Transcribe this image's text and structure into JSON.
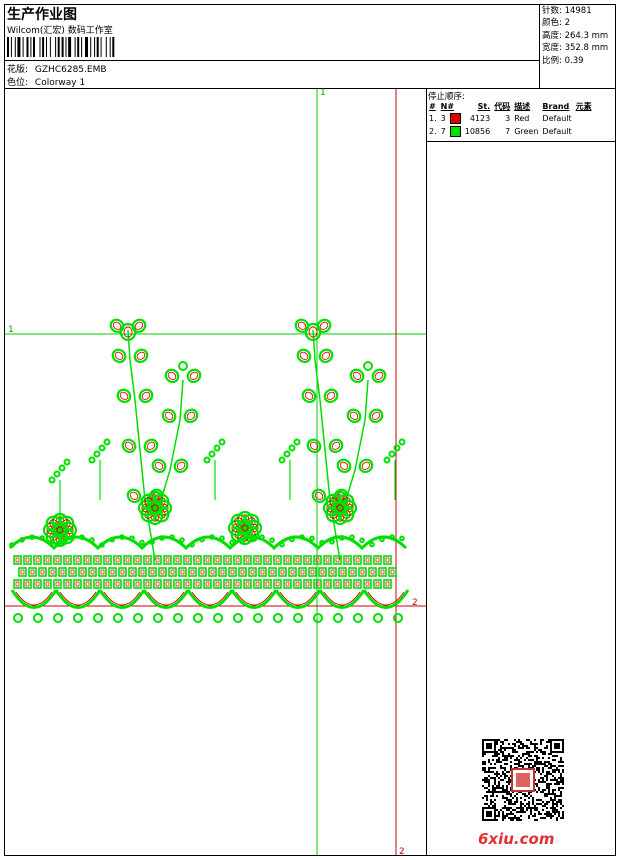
{
  "header": {
    "title": "生产作业图",
    "company": "Wilcom(汇宏) 数码工作室",
    "pattern_label": "花版:",
    "pattern_value": "GZHC6285.EMB",
    "colorway_label": "色位:",
    "colorway_value": "Colorway 1"
  },
  "stats": [
    {
      "label": "针数:",
      "value": "14981"
    },
    {
      "label": "颜色:",
      "value": "2"
    },
    {
      "label": "高度:",
      "value": "264.3 mm"
    },
    {
      "label": "宽度:",
      "value": "352.8 mm"
    },
    {
      "label": "比例:",
      "value": "0.39"
    }
  ],
  "stop_sequence": {
    "title": "停止顺序:",
    "columns": [
      "#",
      "N#",
      "St.",
      "代码",
      "描述",
      "Brand",
      "元素"
    ],
    "rows": [
      {
        "num": "1.",
        "n": "3",
        "color": "#e00000",
        "stitches": "4123",
        "code": "3",
        "desc": "Red",
        "brand": "Default"
      },
      {
        "num": "2.",
        "n": "7",
        "color": "#00e000",
        "stitches": "10856",
        "code": "7",
        "desc": "Green",
        "brand": "Default"
      }
    ]
  },
  "guides": {
    "green_top": "1",
    "green_left": "1",
    "red_right": "2",
    "red_bottom": "2"
  },
  "colors": {
    "red": "#e00000",
    "green": "#00e000"
  },
  "watermark": "6xiu.com"
}
